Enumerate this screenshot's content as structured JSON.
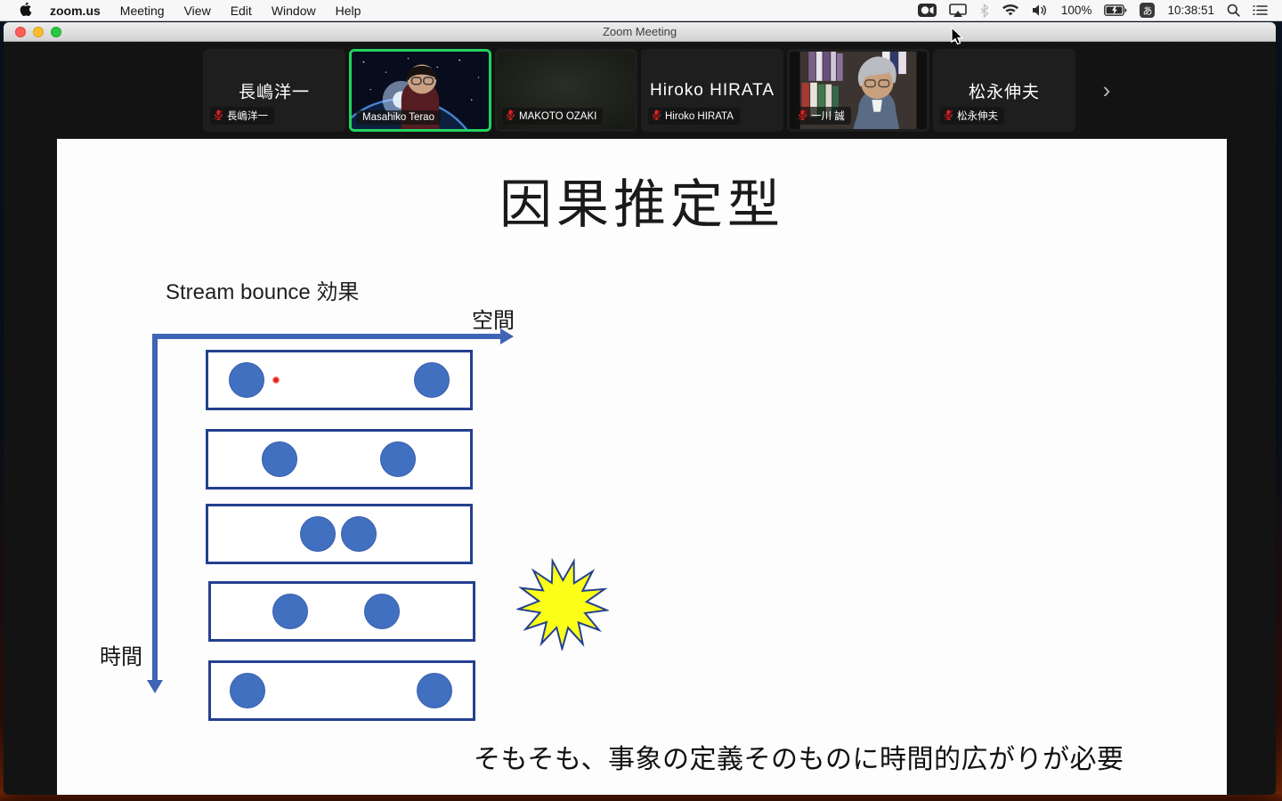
{
  "menu_bar": {
    "app_name": "zoom.us",
    "menus": [
      "Meeting",
      "View",
      "Edit",
      "Window",
      "Help"
    ],
    "status": {
      "battery": "100%",
      "ime": "あ",
      "clock": "10:38:51"
    }
  },
  "window": {
    "title": "Zoom Meeting"
  },
  "participants": [
    {
      "name": "長嶋洋一",
      "label": "長嶋洋一",
      "type": "text",
      "muted": true,
      "active": false
    },
    {
      "name": "Masahiko Terao",
      "label": "Masahiko Terao",
      "type": "video-space",
      "muted": false,
      "active": true
    },
    {
      "name": "MAKOTO OZAKI",
      "label": "MAKOTO OZAKI",
      "type": "video-dark",
      "muted": true,
      "active": false
    },
    {
      "name": "Hiroko HIRATA",
      "label": "Hiroko HIRATA",
      "type": "text",
      "muted": true,
      "active": false
    },
    {
      "name": "一川 誠",
      "label": "一川 誠",
      "type": "video-photo",
      "muted": true,
      "active": false
    },
    {
      "name": "松永伸夫",
      "label": "松永伸夫",
      "type": "text",
      "muted": true,
      "active": false
    }
  ],
  "strip": {
    "next_label": "›"
  },
  "slide": {
    "title": "因果推定型",
    "subtitle": "Stream bounce 効果",
    "space_axis_label": "空間",
    "time_axis_label": "時間",
    "bottom_text": "そもそも、事象の定義そのものに時間的広がりが必要",
    "colors": {
      "ball": "#4270c0",
      "frame_outline": "#24408e",
      "axis_arrow": "#3f63b5",
      "star_fill": "#fbff17",
      "laser_dot": "#ff3b30",
      "active_speaker_border": "#21d35f"
    },
    "rows": [
      {
        "circles_pct": [
          14.7,
          85.3
        ],
        "laser_pct": 26
      },
      {
        "circles_pct": [
          27.3,
          72.3
        ]
      },
      {
        "circles_pct": [
          42.0,
          57.5
        ]
      },
      {
        "circles_pct": [
          30.3,
          65.3
        ]
      },
      {
        "circles_pct": [
          14.1,
          85.5
        ]
      }
    ]
  }
}
